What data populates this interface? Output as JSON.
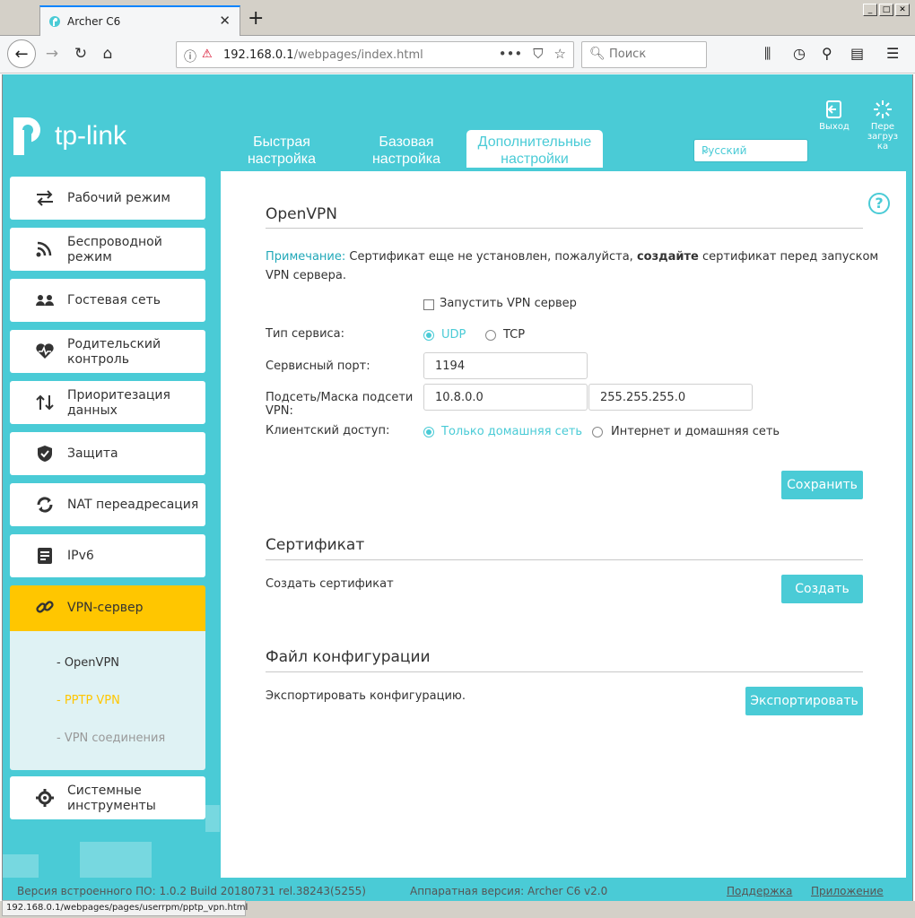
{
  "browser": {
    "tab_title": "Archer C6",
    "new_tab": "+",
    "url_host": "192.168.0.1",
    "url_path": "/webpages/index.html",
    "search_placeholder": "Поиск",
    "status_url": "192.168.0.1/webpages/pages/userrpm/pptp_vpn.html"
  },
  "header": {
    "logo_text": "tp-link",
    "tabs": [
      {
        "line1": "Быстрая",
        "line2": "настройка"
      },
      {
        "line1": "Базовая",
        "line2": "настройка"
      },
      {
        "line1": "Дополнительные",
        "line2": "настройки"
      }
    ],
    "language": "Русский",
    "logout": "Выход",
    "reboot_line1": "Пере",
    "reboot_line2": "загруз",
    "reboot_line3": "ка"
  },
  "sidebar": {
    "items": [
      {
        "line1": "Рабочий режим",
        "line2": ""
      },
      {
        "line1": "Беспроводной",
        "line2": "режим"
      },
      {
        "line1": "Гостевая сеть",
        "line2": ""
      },
      {
        "line1": "Родительский",
        "line2": "контроль"
      },
      {
        "line1": "Приоритезация",
        "line2": "данных"
      },
      {
        "line1": "Защита",
        "line2": ""
      },
      {
        "line1": "NAT переадресация",
        "line2": ""
      },
      {
        "line1": "IPv6",
        "line2": ""
      },
      {
        "line1": "VPN-сервер",
        "line2": ""
      },
      {
        "line1": "Системные",
        "line2": "инструменты"
      }
    ],
    "subitems": [
      "- OpenVPN",
      "- PPTP VPN",
      "- VPN соединения"
    ]
  },
  "openvpn": {
    "title": "OpenVPN",
    "note_label": "Примечание:",
    "note_text_1": "Сертификат еще не установлен, пожалуйста,",
    "note_bold": "создайте",
    "note_text_2": "сертификат перед запуском",
    "note_text_3": "VPN сервера.",
    "enable_label": "Запустить VPN сервер",
    "service_type_label": "Тип сервиса:",
    "udp": "UDP",
    "tcp": "TCP",
    "port_label": "Сервисный порт:",
    "port_value": "1194",
    "subnet_label_1": "Подсеть/Маска подсети",
    "subnet_label_2": "VPN:",
    "subnet_value": "10.8.0.0",
    "mask_value": "255.255.255.0",
    "client_access_label": "Клиентский доступ:",
    "home_only": "Только домашняя сеть",
    "internet_home": "Интернет и домашняя сеть",
    "save_button": "Сохранить"
  },
  "certificate": {
    "title": "Сертификат",
    "create_label": "Создать сертификат",
    "create_button": "Создать"
  },
  "config_file": {
    "title": "Файл конфигурации",
    "export_label": "Экспортировать конфигурацию.",
    "export_button": "Экспортировать"
  },
  "footer": {
    "firmware": "Версия встроенного ПО: 1.0.2 Build 20180731 rel.38243(5255)",
    "hardware": "Аппаратная версия: Archer C6 v2.0",
    "support": "Поддержка",
    "app": "Приложение"
  },
  "colors": {
    "accent": "#4acbd6",
    "active_menu": "#ffc600",
    "sub_active": "#ffc600",
    "note_blue": "#21a8b8"
  }
}
